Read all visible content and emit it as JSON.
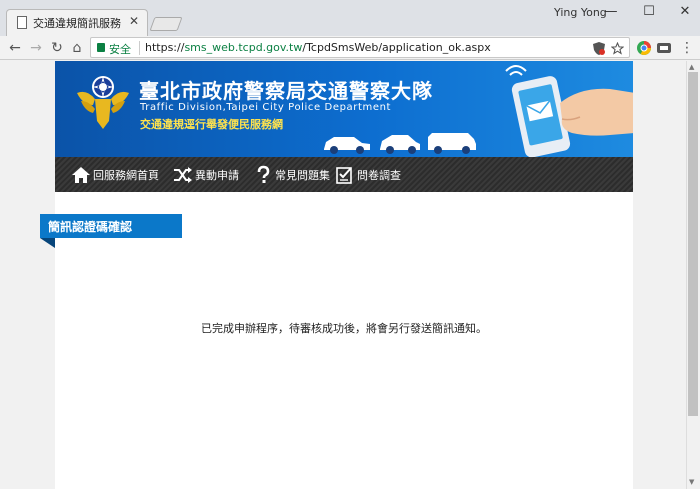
{
  "browser": {
    "tab_title": "交通違規簡訊服務",
    "tab_close": "✕",
    "user_name": "Ying Yong",
    "window_controls": {
      "minimize": "—",
      "maximize": "☐",
      "close": "✕"
    },
    "nav": {
      "back": "←",
      "forward": "→",
      "reload": "↻",
      "home": "⌂"
    },
    "security_label": "安全",
    "url_scheme": "https://",
    "url_host": "sms_web.tcpd.gov.tw",
    "url_path": "/TcpdSmsWeb/application_ok.aspx",
    "icons": [
      "shield-icon",
      "star-icon",
      "chrome-extension-icon",
      "menu-icon"
    ]
  },
  "header": {
    "title": "臺北市政府警察局交通警察大隊",
    "subtitle": "Traffic Division,Taipei City Police Department",
    "slogan": "交通違規逕行舉發便民服務網"
  },
  "menu": {
    "items": [
      {
        "label": "回服務網首頁",
        "icon": "home-icon"
      },
      {
        "label": "異動申請",
        "icon": "shuffle-icon"
      },
      {
        "label": "常見問題集",
        "icon": "question-icon"
      },
      {
        "label": "問卷調查",
        "icon": "checklist-icon"
      }
    ]
  },
  "section": {
    "title": "簡訊認證碼確認"
  },
  "main": {
    "message": "已完成申辦程序，待審核成功後，將會另行發送簡訊通知。"
  },
  "colors": {
    "banner": "#0d6ed0",
    "section_tab": "#0b78c9",
    "menubar": "#333333",
    "slogan": "#ffe34d",
    "secure": "#0b8043"
  }
}
